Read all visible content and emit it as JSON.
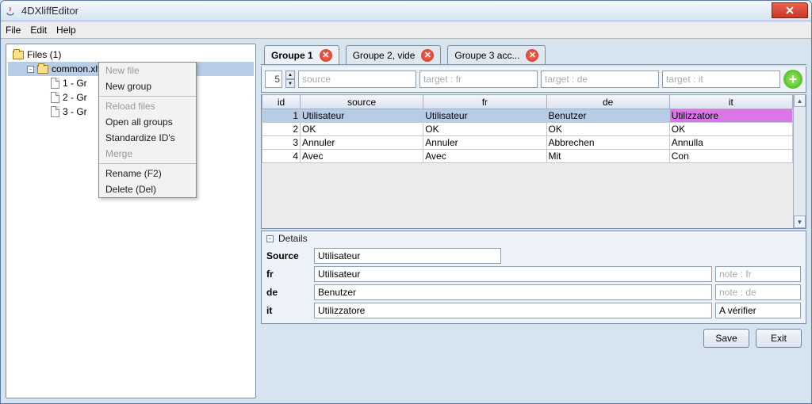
{
  "window": {
    "title": "4DXliffEditor"
  },
  "menubar": [
    "File",
    "Edit",
    "Help"
  ],
  "tree": {
    "root": "Files (1)",
    "selected": "common.xlf (3)",
    "children": [
      "1 - Gr",
      "2 - Gr",
      "3 - Gr"
    ]
  },
  "context_menu": {
    "items": [
      {
        "label": "New file",
        "disabled": true
      },
      {
        "label": "New group",
        "disabled": false
      },
      {
        "sep": true
      },
      {
        "label": "Reload files",
        "disabled": true
      },
      {
        "label": "Open all groups",
        "disabled": false
      },
      {
        "label": "Standardize ID's",
        "disabled": false
      },
      {
        "label": "Merge",
        "disabled": true
      },
      {
        "sep": true
      },
      {
        "label": "Rename (F2)",
        "disabled": false
      },
      {
        "label": "Delete (Del)",
        "disabled": false
      }
    ]
  },
  "tabs": [
    {
      "label": "Groupe 1",
      "active": true
    },
    {
      "label": "Groupe 2, vide",
      "active": false
    },
    {
      "label": "Groupe 3 acc...",
      "active": false
    }
  ],
  "toolbar": {
    "spinner_value": "5",
    "search_source_ph": "source",
    "search_fr_ph": "target : fr",
    "search_de_ph": "target : de",
    "search_it_ph": "target : it"
  },
  "grid": {
    "columns": [
      "id",
      "source",
      "fr",
      "de",
      "it"
    ],
    "rows": [
      {
        "id": "1",
        "source": "Utilisateur",
        "fr": "Utilisateur",
        "de": "Benutzer",
        "it": "Utilizzatore",
        "selected": true,
        "hot_col": "it"
      },
      {
        "id": "2",
        "source": "OK",
        "fr": "OK",
        "de": "OK",
        "it": "OK"
      },
      {
        "id": "3",
        "source": "Annuler",
        "fr": "Annuler",
        "de": "Abbrechen",
        "it": "Annulla"
      },
      {
        "id": "4",
        "source": "Avec",
        "fr": "Avec",
        "de": "Mit",
        "it": "Con"
      }
    ]
  },
  "details": {
    "title": "Details",
    "source": {
      "label": "Source",
      "value": "Utilisateur"
    },
    "fr": {
      "label": "fr",
      "value": "Utilisateur",
      "note_ph": "note : fr"
    },
    "de": {
      "label": "de",
      "value": "Benutzer",
      "note_ph": "note : de"
    },
    "it": {
      "label": "it",
      "value": "Utilizzatore",
      "note": "A vérifier"
    }
  },
  "footer": {
    "save": "Save",
    "exit": "Exit"
  }
}
